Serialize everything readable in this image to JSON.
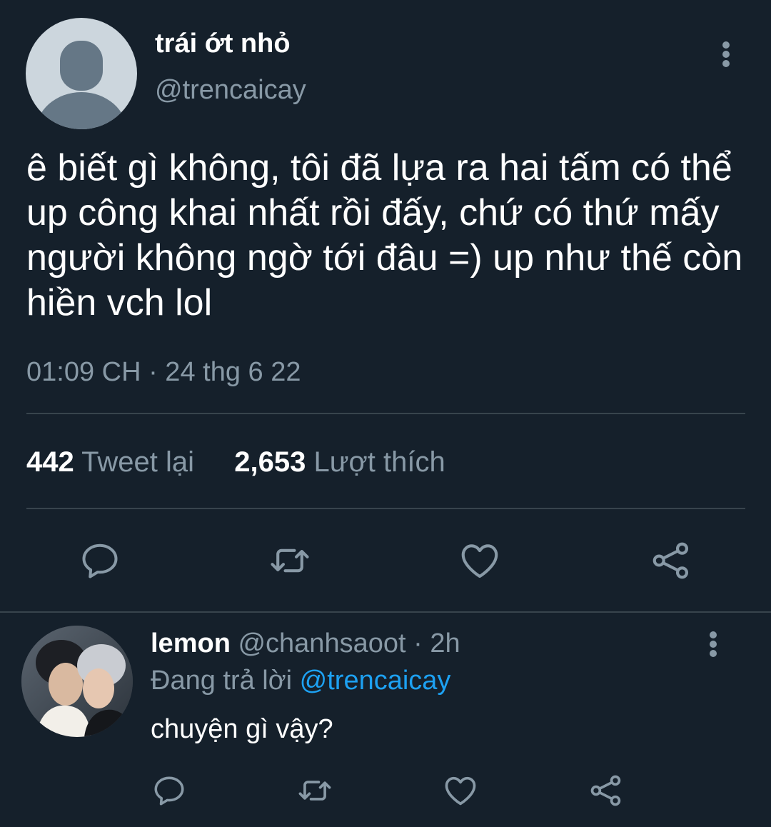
{
  "tweet": {
    "display_name": "trái ớt nhỏ",
    "handle": "@trencaicay",
    "text": "ê biết gì không, tôi đã lựa ra hai tấm có thể up công khai nhất rồi đấy, chứ có thứ mấy người không ngờ tới đâu =) up như thế còn hiền vch lol",
    "timestamp": "01:09 CH · 24 thg 6 22",
    "retweet_count": "442",
    "retweet_label": "Tweet lại",
    "like_count": "2,653",
    "like_label": "Lượt thích",
    "icons": [
      "more-icon",
      "reply-icon",
      "retweet-icon",
      "like-icon",
      "share-icon"
    ]
  },
  "reply": {
    "display_name": "lemon",
    "handle": "@chanhsaoot",
    "time": "· 2h",
    "replying_prefix": "Đang trả lời",
    "replying_to": "@trencaicay",
    "text": "chuyện gì vậy?"
  },
  "colors": {
    "background": "#15202b",
    "secondary_text": "#8899a6",
    "divider": "#38444d",
    "link": "#1da1f2",
    "icon": "#8899a6"
  }
}
